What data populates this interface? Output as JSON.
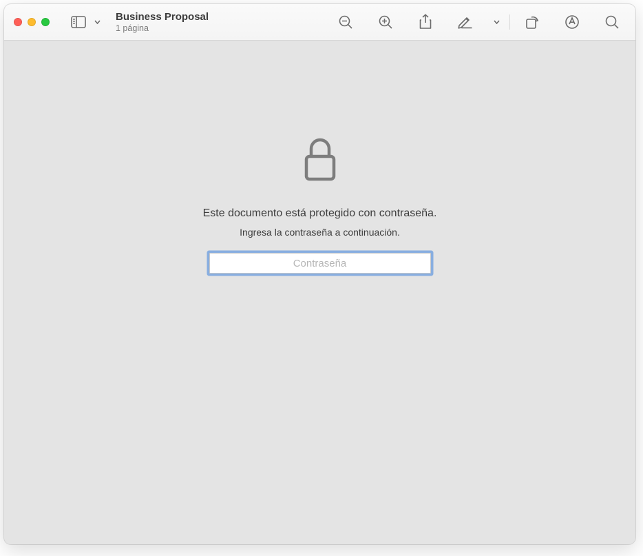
{
  "header": {
    "title": "Business Proposal",
    "subtitle": "1 página"
  },
  "content": {
    "message_primary": "Este documento está protegido con contraseña.",
    "message_secondary": "Ingresa la contraseña a continuación.",
    "password_placeholder": "Contraseña"
  }
}
